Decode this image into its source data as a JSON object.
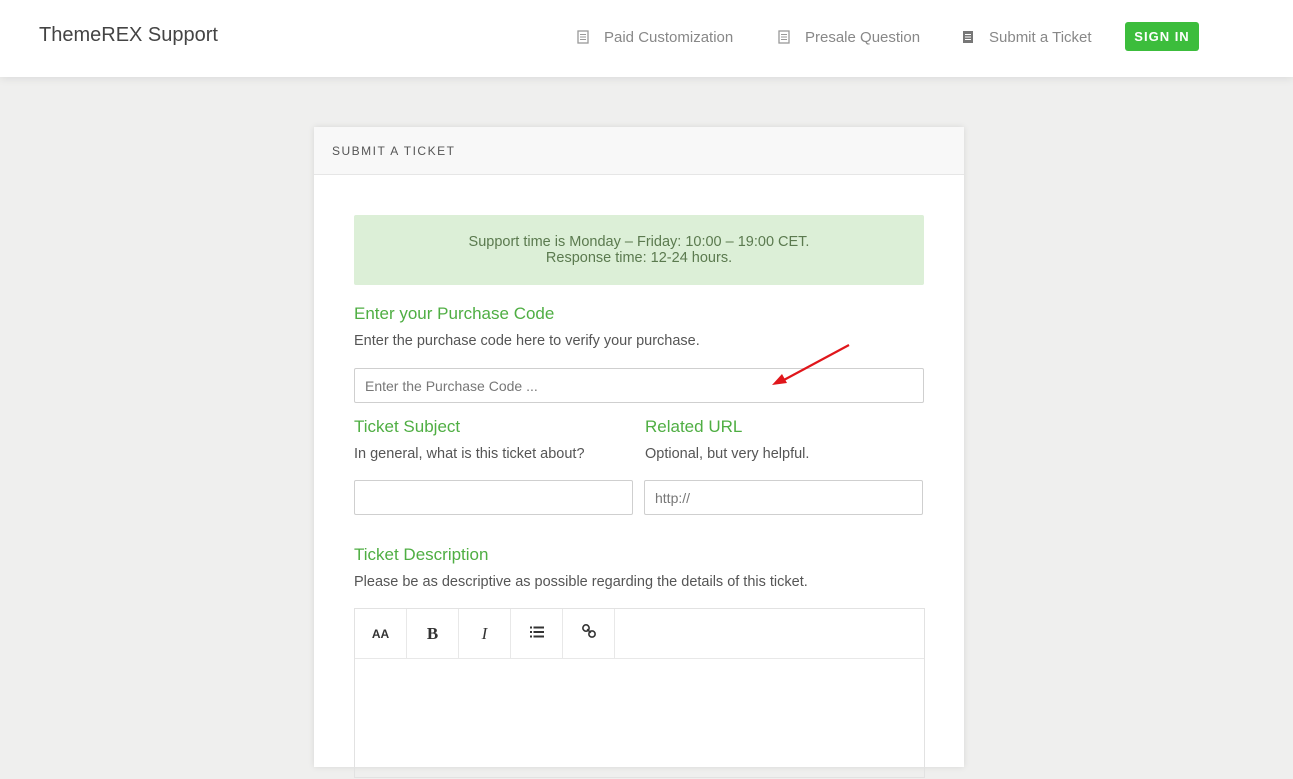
{
  "header": {
    "brand": "ThemeREX Support",
    "nav": [
      {
        "label": "Paid Customization",
        "icon": "document-icon"
      },
      {
        "label": "Presale Question",
        "icon": "document-icon"
      },
      {
        "label": "Submit a Ticket",
        "icon": "document-filled-icon"
      }
    ],
    "signin_label": "SIGN IN"
  },
  "card": {
    "title": "SUBMIT A TICKET",
    "notice": {
      "line1": "Support time is Monday – Friday: 10:00 – 19:00 CET.",
      "line2": "Response time: 12-24 hours."
    },
    "purchase": {
      "title": "Enter your Purchase Code",
      "desc": "Enter the purchase code here to verify your purchase.",
      "placeholder": "Enter the Purchase Code ..."
    },
    "subject": {
      "title": "Ticket Subject",
      "desc": "In general, what is this ticket about?",
      "value": ""
    },
    "url": {
      "title": "Related URL",
      "desc": "Optional, but very helpful.",
      "placeholder": "http://"
    },
    "description": {
      "title": "Ticket Description",
      "desc": "Please be as descriptive as possible regarding the details of this ticket."
    },
    "toolbar": {
      "font_size_glyph": "AA",
      "bold_glyph": "B",
      "italic_glyph": "I"
    }
  },
  "colors": {
    "accent_green": "#4fae43",
    "signin_green": "#3cbd3c",
    "notice_bg": "#dcefd7",
    "annotation_arrow": "#e0161b"
  }
}
